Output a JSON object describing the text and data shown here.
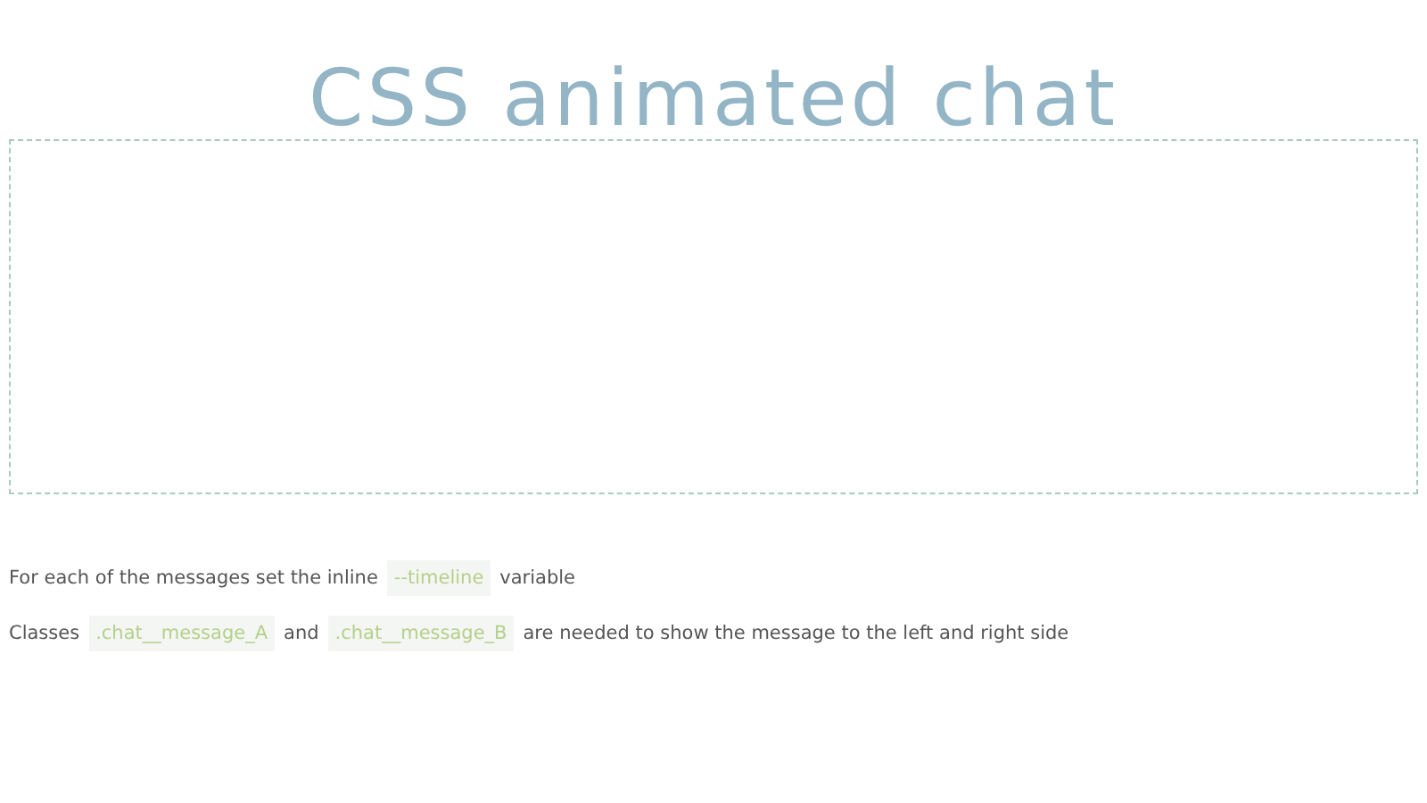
{
  "title": "CSS animated chat",
  "chat_area": {
    "kind": "empty"
  },
  "notes": [
    {
      "parts": [
        {
          "kind": "text",
          "text": "For each of the messages set the inline"
        },
        {
          "kind": "code",
          "text": "--timeline"
        },
        {
          "kind": "text",
          "text": "variable"
        }
      ]
    },
    {
      "parts": [
        {
          "kind": "text",
          "text": "Classes"
        },
        {
          "kind": "code",
          "text": ".chat__message_A"
        },
        {
          "kind": "text",
          "text": "and"
        },
        {
          "kind": "code",
          "text": ".chat__message_B"
        },
        {
          "kind": "text",
          "text": "are needed to show the message to the left and right side"
        }
      ]
    }
  ]
}
